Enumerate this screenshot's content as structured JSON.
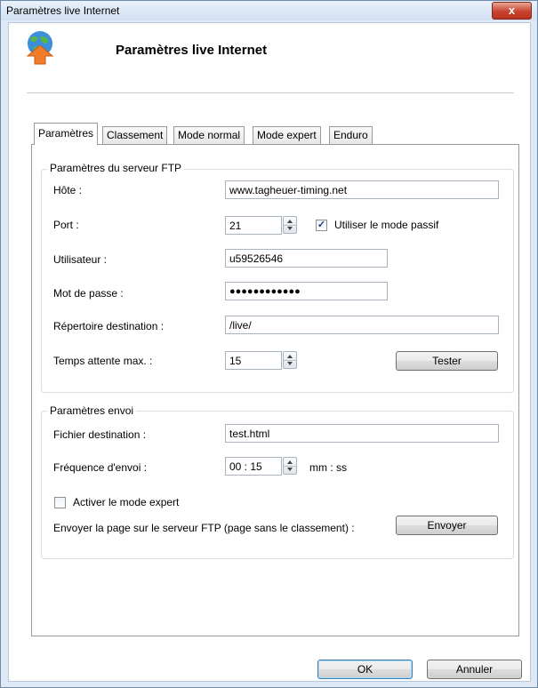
{
  "window": {
    "title": "Paramètres live Internet",
    "close_glyph": "x"
  },
  "header": {
    "title": "Paramètres live Internet",
    "icon": "globe-upload-icon"
  },
  "tabs": [
    {
      "label": "Paramètres",
      "active": true
    },
    {
      "label": "Classement",
      "active": false
    },
    {
      "label": "Mode normal",
      "active": false
    },
    {
      "label": "Mode expert",
      "active": false
    },
    {
      "label": "Enduro",
      "active": false
    }
  ],
  "ftp": {
    "group_label": "Paramètres du serveur FTP",
    "host_label": "Hôte :",
    "host_value": "www.tagheuer-timing.net",
    "port_label": "Port :",
    "port_value": "21",
    "passive_label": "Utiliser le mode passif",
    "passive_checked": true,
    "user_label": "Utilisateur :",
    "user_value": "u59526546",
    "password_label": "Mot de passe :",
    "password_value": "●●●●●●●●●●●●",
    "dest_dir_label": "Répertoire destination :",
    "dest_dir_value": "/live/",
    "timeout_label": "Temps attente max. :",
    "timeout_value": "15",
    "test_button": "Tester"
  },
  "send": {
    "group_label": "Paramètres envoi",
    "dest_file_label": "Fichier destination :",
    "dest_file_value": "test.html",
    "freq_label": "Fréquence d'envoi :",
    "freq_value": "00 : 15",
    "freq_unit": "mm : ss",
    "expert_label": "Activer le mode expert",
    "expert_checked": false,
    "send_page_label": "Envoyer la page sur le serveur FTP (page sans le classement) :",
    "send_button": "Envoyer"
  },
  "footer": {
    "ok_button": "OK",
    "cancel_button": "Annuler"
  }
}
